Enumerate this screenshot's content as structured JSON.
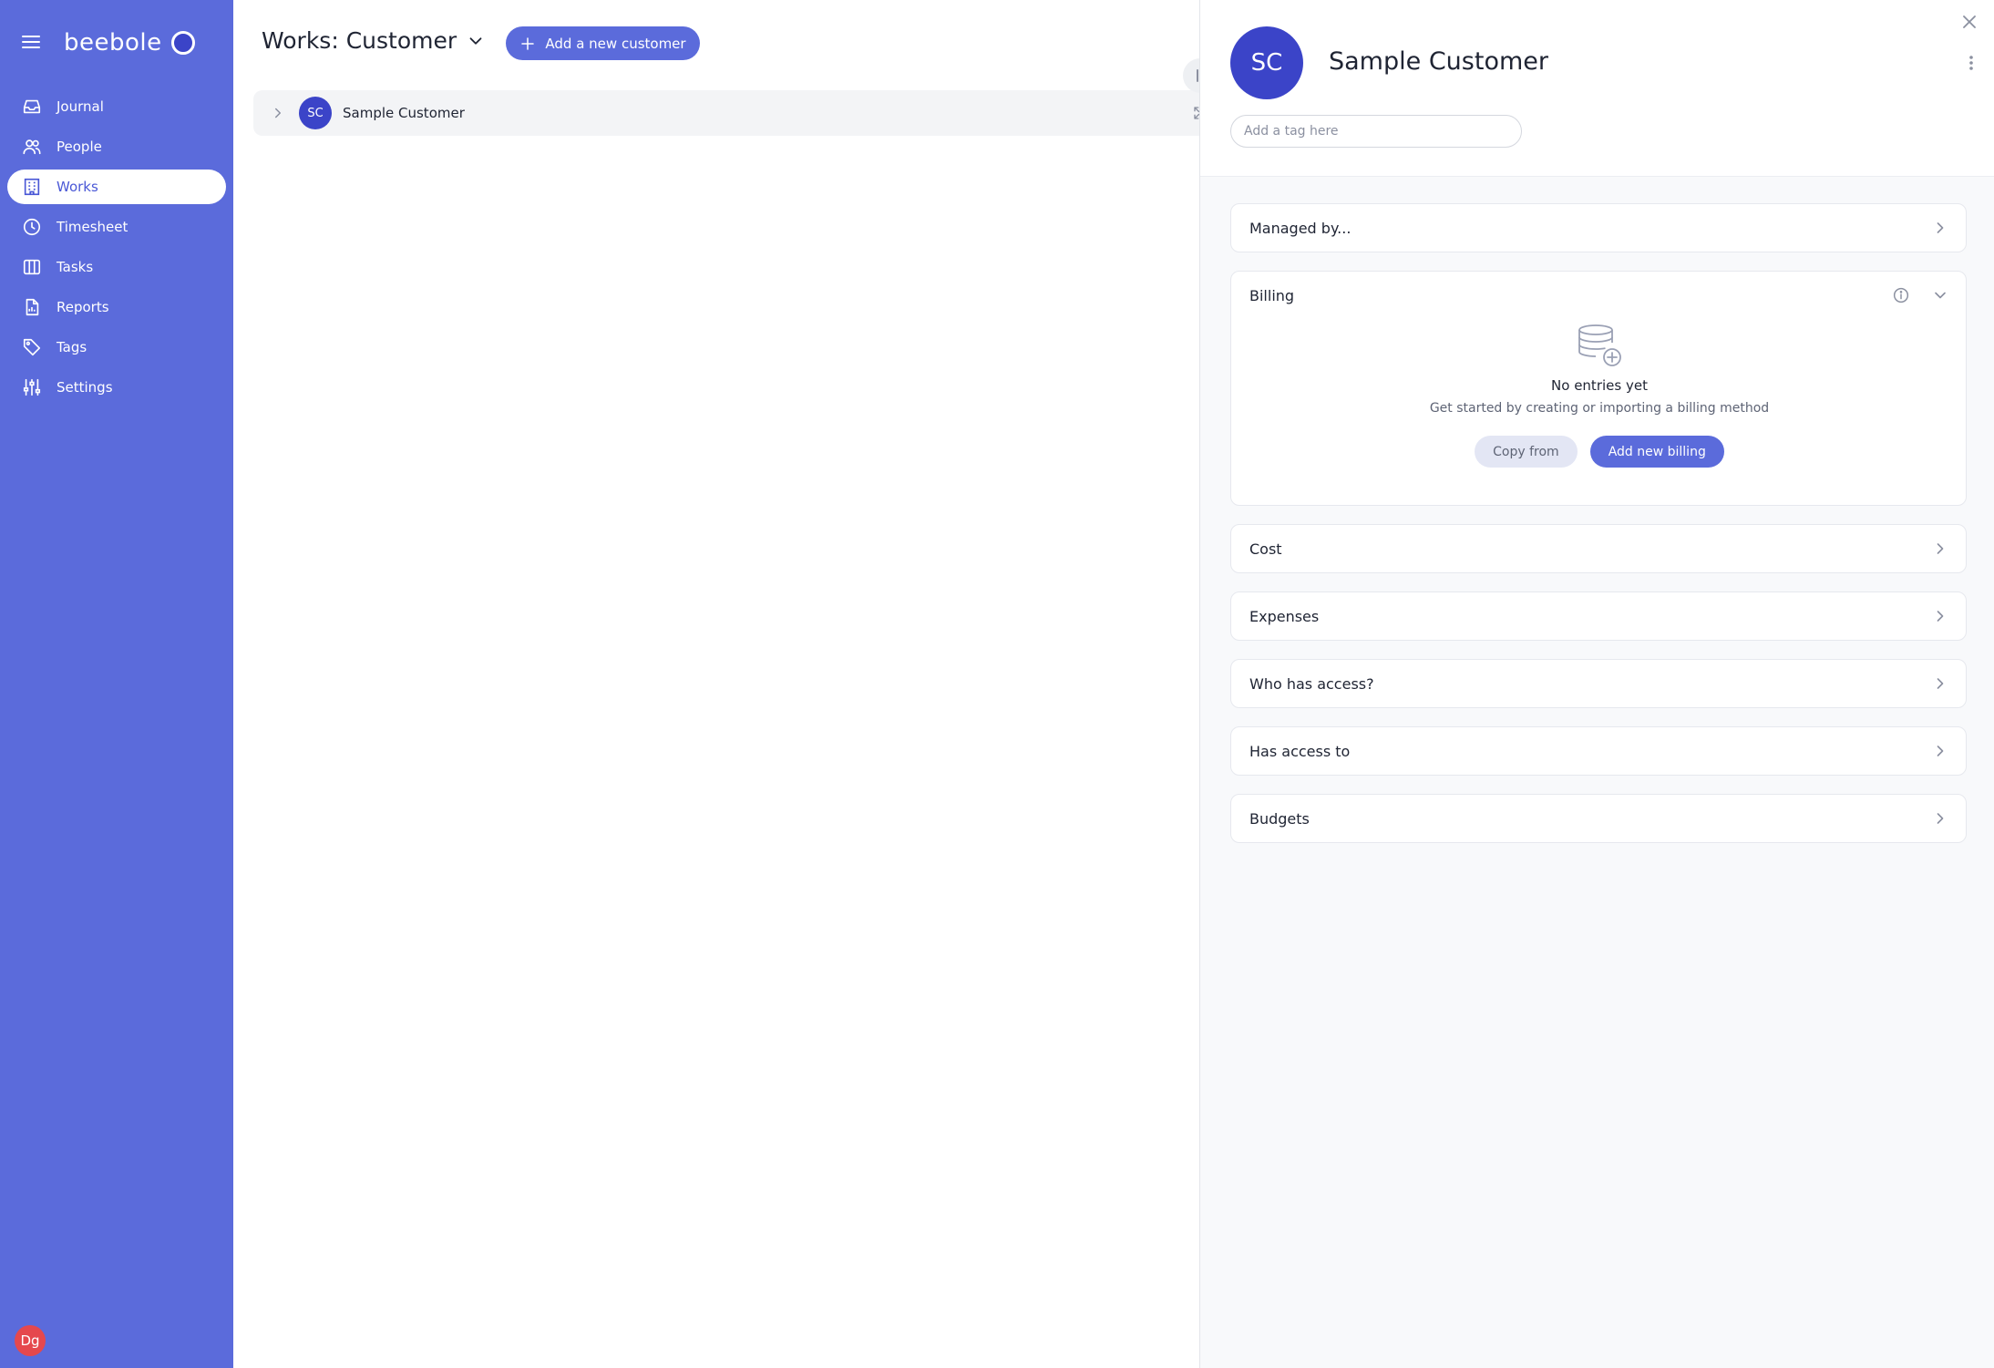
{
  "app": {
    "brand": "beebole",
    "user_initials": "Dg"
  },
  "sidebar": {
    "items": [
      {
        "label": "Journal",
        "icon": "inbox-icon",
        "active": false
      },
      {
        "label": "People",
        "icon": "people-icon",
        "active": false
      },
      {
        "label": "Works",
        "icon": "building-icon",
        "active": true
      },
      {
        "label": "Timesheet",
        "icon": "clock-icon",
        "active": false
      },
      {
        "label": "Tasks",
        "icon": "columns-icon",
        "active": false
      },
      {
        "label": "Reports",
        "icon": "report-icon",
        "active": false
      },
      {
        "label": "Tags",
        "icon": "tag-icon",
        "active": false
      },
      {
        "label": "Settings",
        "icon": "sliders-icon",
        "active": false
      }
    ]
  },
  "main": {
    "title": "Works: Customer",
    "add_button_label": "Add a new customer",
    "rows": [
      {
        "initials": "SC",
        "name": "Sample Customer"
      }
    ]
  },
  "panel": {
    "initials": "SC",
    "title": "Sample Customer",
    "tag_placeholder": "Add a tag here",
    "sections": {
      "managed_by": "Managed by...",
      "billing": "Billing",
      "cost": "Cost",
      "expenses": "Expenses",
      "who_has_access": "Who has access?",
      "has_access_to": "Has access to",
      "budgets": "Budgets"
    },
    "billing_empty": {
      "title": "No entries yet",
      "subtitle": "Get started by creating or importing a billing method",
      "copy_label": "Copy from",
      "add_label": "Add new billing"
    }
  },
  "colors": {
    "sidebar_bg": "#5b6bdb",
    "accent": "#5b6bdb",
    "avatar_bg": "#3b44c8",
    "user_avatar_bg": "#e5484d"
  }
}
